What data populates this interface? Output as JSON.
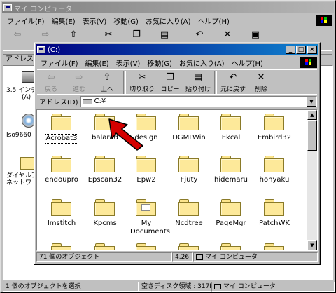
{
  "back_window": {
    "title": "マイ コンピュータ",
    "menu": [
      "ファイル(F)",
      "編集(E)",
      "表示(V)",
      "移動(G)",
      "お気に入り(A)",
      "ヘルプ(H)"
    ],
    "address_label": "アドレス(D",
    "left_items": [
      "3.5 インチ",
      "(A)",
      "Iso9660",
      "ダイヤルア",
      "ネットワー"
    ],
    "status_left": "1 個のオブジェクトを選択",
    "status_mid": "空きディスク領域 : 317M",
    "status_right": "マイ コンピュータ"
  },
  "front_window": {
    "title": "(C:)",
    "menu": [
      "ファイル(F)",
      "編集(E)",
      "表示(V)",
      "移動(G)",
      "お気に入り(A)",
      "ヘルプ(H)"
    ],
    "toolbar": {
      "back": "戻る",
      "forward": "進む",
      "up": "上へ",
      "cut": "切り取り",
      "copy": "コピー",
      "paste": "貼り付け",
      "undo": "元に戻す",
      "delete": "削除"
    },
    "address_label": "アドレス(D)",
    "address_value": "C:¥",
    "folders": [
      "Acrobat3",
      "balarad",
      "design",
      "DGMLWin",
      "Ekcal",
      "Embird32",
      "endoupro",
      "Epscan32",
      "Epw2",
      "Fjuty",
      "hidemaru",
      "honyaku",
      "Imstitch",
      "Kpcms",
      "My Documents",
      "Ncdtree",
      "PageMgr",
      "PatchWK"
    ],
    "status_left": "71 個のオブジェクト",
    "status_mid": "4.26",
    "status_right": "マイ コンピュータ"
  },
  "colors": {
    "title_active": "#000080",
    "pointer": "#d40000",
    "folder": "#fde99a"
  }
}
